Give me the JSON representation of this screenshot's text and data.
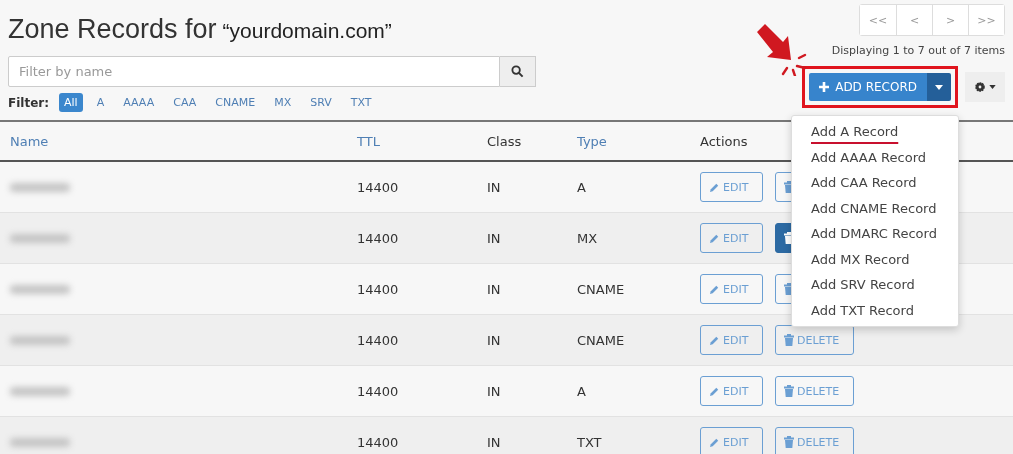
{
  "title": "Zone Records for",
  "domain": "“yourdomain.com”",
  "search": {
    "placeholder": "Filter by name"
  },
  "filter": {
    "label": "Filter:",
    "options": [
      {
        "label": "All",
        "selected": true
      },
      {
        "label": "A",
        "selected": false
      },
      {
        "label": "AAAA",
        "selected": false
      },
      {
        "label": "CAA",
        "selected": false
      },
      {
        "label": "CNAME",
        "selected": false
      },
      {
        "label": "MX",
        "selected": false
      },
      {
        "label": "SRV",
        "selected": false
      },
      {
        "label": "TXT",
        "selected": false
      }
    ]
  },
  "pager": {
    "buttons": [
      "<<",
      "<",
      ">",
      ">>"
    ],
    "status": "Displaying 1 to 7 out of 7 items"
  },
  "add_record": {
    "label": "ADD RECORD",
    "expanded": true
  },
  "add_menu": {
    "items": [
      {
        "label": "Add A Record",
        "underlined": true
      },
      {
        "label": "Add AAAA Record",
        "underlined": false
      },
      {
        "label": "Add CAA Record",
        "underlined": false
      },
      {
        "label": "Add CNAME Record",
        "underlined": false
      },
      {
        "label": "Add DMARC Record",
        "underlined": false
      },
      {
        "label": "Add MX Record",
        "underlined": false
      },
      {
        "label": "Add SRV Record",
        "underlined": false
      },
      {
        "label": "Add TXT Record",
        "underlined": false
      }
    ]
  },
  "table": {
    "columns": [
      {
        "label": "Name",
        "sortable": true
      },
      {
        "label": "TTL",
        "sortable": true
      },
      {
        "label": "Class",
        "sortable": false
      },
      {
        "label": "Type",
        "sortable": true
      },
      {
        "label": "Actions",
        "sortable": false
      }
    ],
    "rows": [
      {
        "ttl": "14400",
        "class": "IN",
        "type": "A",
        "edit": "EDIT",
        "delete": {
          "active": false
        }
      },
      {
        "ttl": "14400",
        "class": "IN",
        "type": "MX",
        "edit": "EDIT",
        "delete": {
          "active": true
        }
      },
      {
        "ttl": "14400",
        "class": "IN",
        "type": "CNAME",
        "edit": "EDIT",
        "delete": {
          "active": false
        }
      },
      {
        "ttl": "14400",
        "class": "IN",
        "type": "CNAME",
        "edit": "EDIT",
        "delete": {
          "label": "DELETE",
          "active": false
        }
      },
      {
        "ttl": "14400",
        "class": "IN",
        "type": "A",
        "edit": "EDIT",
        "delete": {
          "label": "DELETE",
          "active": false
        }
      },
      {
        "ttl": "14400",
        "class": "IN",
        "type": "TXT",
        "edit": "EDIT",
        "delete": {
          "label": "DELETE",
          "active": false
        }
      }
    ]
  }
}
